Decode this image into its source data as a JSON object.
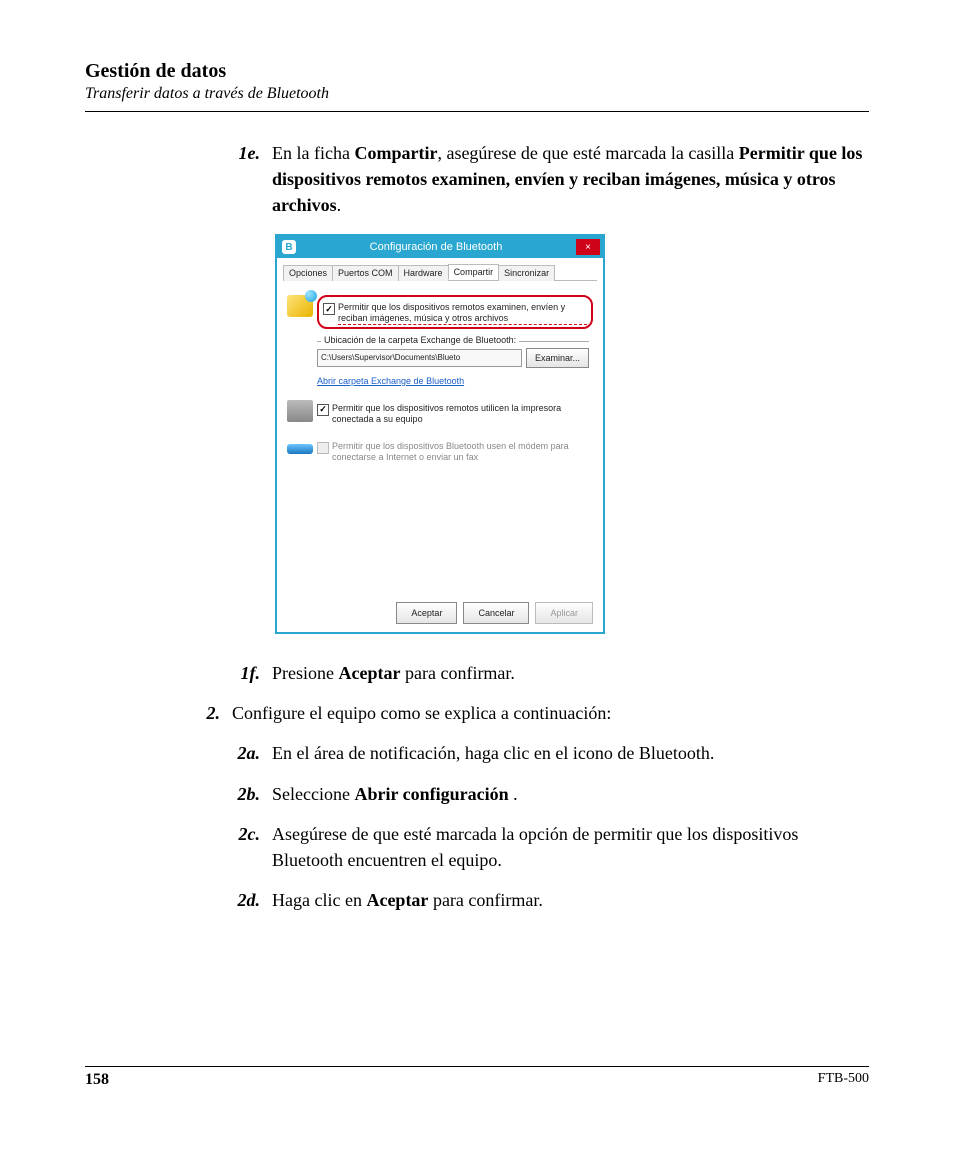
{
  "header": {
    "title": "Gestión de datos",
    "subtitle": "Transferir datos a través de Bluetooth"
  },
  "steps": {
    "s1e": {
      "num": "1e.",
      "pre": "En la ficha ",
      "bold1": "Compartir",
      "mid": ", asegúrese de que esté marcada la casilla ",
      "bold2": "Permitir que los dispositivos remotos examinen, envíen y reciban imágenes, música y otros archivos",
      "post": "."
    },
    "s1f": {
      "num": "1f.",
      "pre": "Presione ",
      "bold1": "Aceptar",
      "post": " para confirmar."
    },
    "s2": {
      "num": "2.",
      "text": "Configure el equipo como se explica a continuación:"
    },
    "s2a": {
      "num": "2a.",
      "text": "En el área de notificación, haga clic en el icono de Bluetooth."
    },
    "s2b": {
      "num": "2b.",
      "pre": "Seleccione ",
      "bold1": "Abrir configuración",
      "post": " ."
    },
    "s2c": {
      "num": "2c.",
      "text": "Asegúrese de que esté marcada la opción de permitir que los dispositivos Bluetooth encuentren el equipo."
    },
    "s2d": {
      "num": "2d.",
      "pre": "Haga clic en ",
      "bold1": "Aceptar",
      "post": " para confirmar."
    }
  },
  "dialog": {
    "title": "Configuración de Bluetooth",
    "bt_glyph": "B",
    "close_glyph": "×",
    "tabs": {
      "t1": "Opciones",
      "t2": "Puertos COM",
      "t3": "Hardware",
      "t4": "Compartir",
      "t5": "Sincronizar"
    },
    "chk1": "Permitir que los dispositivos remotos examinen, envíen y reciban imágenes, música y otros archivos",
    "folder_legend": "Ubicación de la carpeta Exchange de Bluetooth:",
    "folder_path": "C:\\Users\\Supervisor\\Documents\\Blueto",
    "browse_btn": "Examinar...",
    "open_link": "Abrir carpeta Exchange de Bluetooth",
    "chk2": "Permitir que los dispositivos remotos utilicen la impresora conectada a su equipo",
    "chk3": "Permitir que los dispositivos Bluetooth usen el módem para conectarse a Internet o enviar un fax",
    "btn_ok": "Aceptar",
    "btn_cancel": "Cancelar",
    "btn_apply": "Aplicar"
  },
  "footer": {
    "page": "158",
    "model": "FTB-500"
  }
}
